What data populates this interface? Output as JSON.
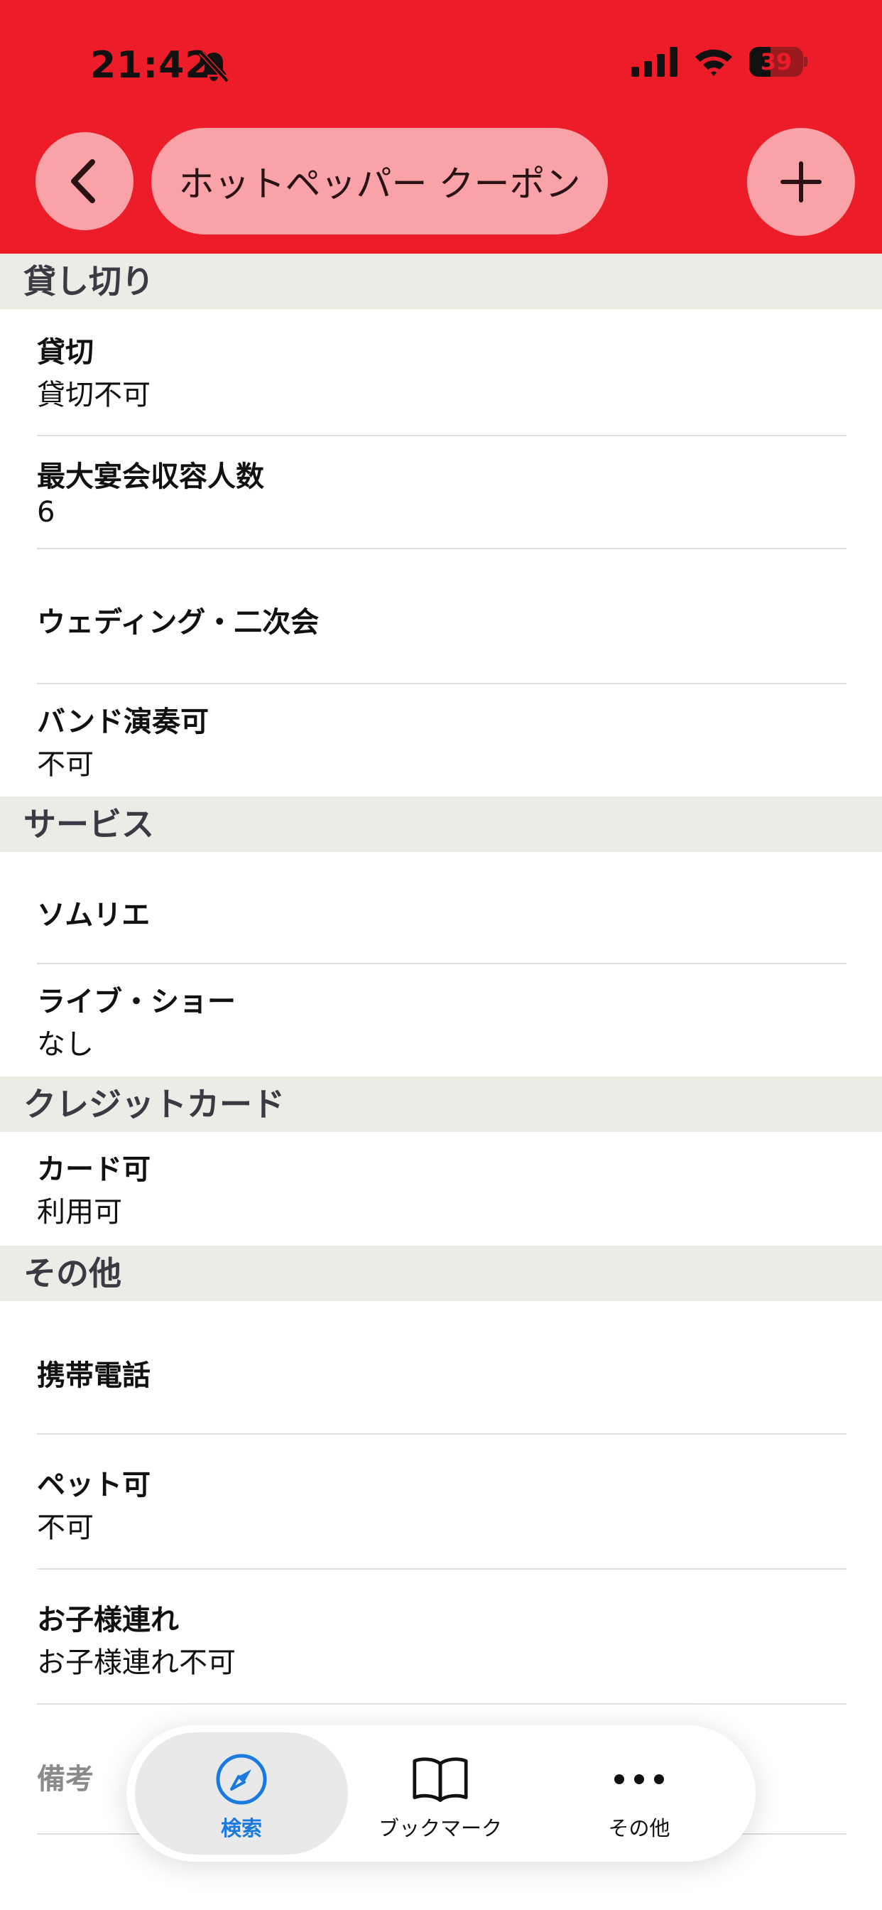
{
  "status_bar": {
    "time": "21:42",
    "battery": "39",
    "battery_level": 0.39
  },
  "nav": {
    "title": "ホットペッパー クーポン"
  },
  "sections": {
    "kashikiri": {
      "title": "貸し切り",
      "rows": [
        {
          "label": "貸切",
          "value": "貸切不可"
        },
        {
          "label": "最大宴会収容人数",
          "value": "6"
        },
        {
          "label": "ウェディング・二次会",
          "value": ""
        },
        {
          "label": "バンド演奏可",
          "value": "不可"
        }
      ]
    },
    "service": {
      "title": "サービス",
      "rows": [
        {
          "label": "ソムリエ",
          "value": ""
        },
        {
          "label": "ライブ・ショー",
          "value": "なし"
        }
      ]
    },
    "credit": {
      "title": "クレジットカード",
      "rows": [
        {
          "label": "カード可",
          "value": "利用可"
        }
      ]
    },
    "other": {
      "title": "その他",
      "rows": [
        {
          "label": "携帯電話",
          "value": ""
        },
        {
          "label": "ペット可",
          "value": "不可"
        },
        {
          "label": "お子様連れ",
          "value": "お子様連れ不可"
        },
        {
          "label": "備考",
          "value": ""
        }
      ]
    }
  },
  "tabbar": {
    "tabs": [
      {
        "label": "検索",
        "icon": "compass-icon",
        "active": true
      },
      {
        "label": "ブックマーク",
        "icon": "book-icon",
        "active": false
      },
      {
        "label": "その他",
        "icon": "more-icon",
        "active": false
      }
    ]
  },
  "colors": {
    "header": "#ec1c28",
    "pill": "#f9a3a8",
    "section_bg": "#ecebe6",
    "active_tab": "#1a7ae0"
  }
}
